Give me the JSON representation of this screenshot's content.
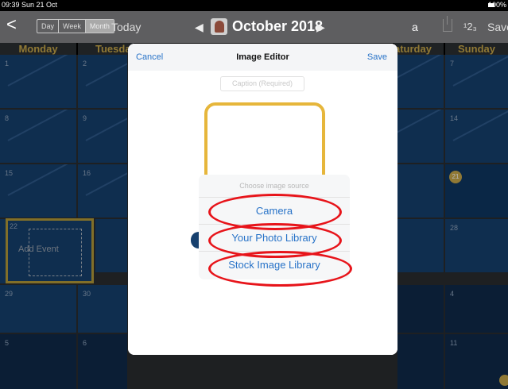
{
  "status_bar": {
    "time": "09:39  Sun 21 Oct",
    "battery": "100%"
  },
  "toolbar": {
    "back": "<",
    "segments": [
      "Day",
      "Week",
      "Month"
    ],
    "today": "Today",
    "prev": "◀",
    "title": "October 2018",
    "next": "▶",
    "lock": "a",
    "numbering": "¹2₃",
    "save": "Save"
  },
  "day_headers": [
    "Monday",
    "Tuesda",
    "aturday",
    "Sunday"
  ],
  "calendar": {
    "numbers": [
      "1",
      "2",
      "7",
      "8",
      "9",
      "14",
      "15",
      "16",
      "21",
      "22",
      "28",
      "29",
      "30",
      "4",
      "5",
      "6",
      "11"
    ],
    "add_event": "Add Event"
  },
  "modal": {
    "cancel": "Cancel",
    "title": "Image Editor",
    "save": "Save",
    "caption_placeholder": "Caption (Required)",
    "sheet": {
      "title": "Choose image source",
      "options": [
        "Camera",
        "Your Photo Library",
        "Stock Image Library"
      ]
    }
  },
  "colors": {
    "accent": "#2873c8",
    "highlight": "#e7141a",
    "gold": "#c8a84a",
    "cell": "#16406e"
  }
}
